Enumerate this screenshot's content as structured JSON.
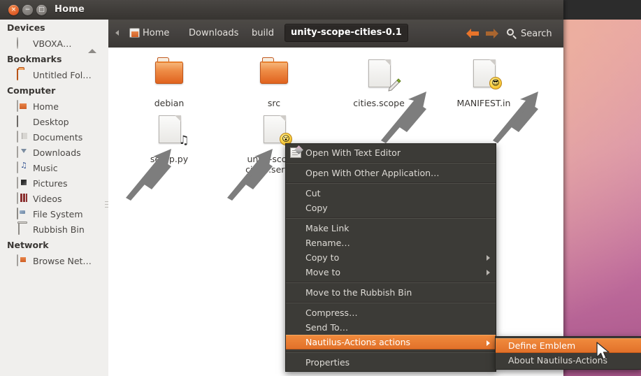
{
  "window": {
    "title": "Home",
    "controls": {
      "close_label": "×",
      "minimize_label": "−",
      "maximize_label": "□"
    }
  },
  "sidebar": {
    "sections": [
      {
        "header": "Devices",
        "items": [
          {
            "label": "VBOXA…",
            "icon": "disc-icon",
            "eject": true
          }
        ]
      },
      {
        "header": "Bookmarks",
        "items": [
          {
            "label": "Untitled Fol…",
            "icon": "folder-icon",
            "eject": false
          }
        ]
      },
      {
        "header": "Computer",
        "items": [
          {
            "label": "Home",
            "icon": "home-icon",
            "eject": false
          },
          {
            "label": "Desktop",
            "icon": "desktop-icon",
            "eject": false
          },
          {
            "label": "Documents",
            "icon": "documents-icon",
            "eject": false
          },
          {
            "label": "Downloads",
            "icon": "downloads-icon",
            "eject": false
          },
          {
            "label": "Music",
            "icon": "music-icon",
            "eject": false
          },
          {
            "label": "Pictures",
            "icon": "pictures-icon",
            "eject": false
          },
          {
            "label": "Videos",
            "icon": "videos-icon",
            "eject": false
          },
          {
            "label": "File System",
            "icon": "harddisk-icon",
            "eject": false
          },
          {
            "label": "Rubbish Bin",
            "icon": "trash-icon",
            "eject": false
          }
        ]
      },
      {
        "header": "Network",
        "items": [
          {
            "label": "Browse Net…",
            "icon": "network-icon",
            "eject": false
          }
        ]
      }
    ]
  },
  "toolbar": {
    "breadcrumbs": [
      {
        "label": "Home",
        "selected": false,
        "has_icon": true
      },
      {
        "label": "Downloads",
        "selected": false,
        "has_icon": false
      },
      {
        "label": "build",
        "selected": false,
        "has_icon": false
      },
      {
        "label": "unity-scope-cities-0.1",
        "selected": true,
        "has_icon": false
      }
    ],
    "back_label": "←",
    "forward_label": "→",
    "search_label": "Search"
  },
  "files": [
    {
      "name": "debian",
      "type": "folder",
      "emblem": null
    },
    {
      "name": "src",
      "type": "folder",
      "emblem": null
    },
    {
      "name": "cities.scope",
      "type": "file",
      "emblem": "pen-emblem"
    },
    {
      "name": "MANIFEST.in",
      "type": "file",
      "emblem": "cool-face-emblem",
      "emblem_glyph": "😎"
    },
    {
      "name": "setup.py",
      "type": "file",
      "emblem": "music-note-emblem",
      "emblem_glyph": "♫"
    },
    {
      "name": "unity-scope-cities.service",
      "type": "file",
      "emblem": "surprised-face-emblem",
      "emblem_glyph": "😮"
    }
  ],
  "context_menu": {
    "items": [
      {
        "label": "Open With Text Editor",
        "icon": "text-editor-icon",
        "submenu": false,
        "highlighted": false
      },
      {
        "separator": true
      },
      {
        "label": "Open With Other Application…",
        "icon": null,
        "submenu": false,
        "highlighted": false
      },
      {
        "separator": true
      },
      {
        "label": "Cut",
        "icon": null,
        "submenu": false,
        "highlighted": false
      },
      {
        "label": "Copy",
        "icon": null,
        "submenu": false,
        "highlighted": false
      },
      {
        "separator": true
      },
      {
        "label": "Make Link",
        "icon": null,
        "submenu": false,
        "highlighted": false
      },
      {
        "label": "Rename…",
        "icon": null,
        "submenu": false,
        "highlighted": false
      },
      {
        "label": "Copy to",
        "icon": null,
        "submenu": true,
        "highlighted": false
      },
      {
        "label": "Move to",
        "icon": null,
        "submenu": true,
        "highlighted": false
      },
      {
        "separator": true
      },
      {
        "label": "Move to the Rubbish Bin",
        "icon": null,
        "submenu": false,
        "highlighted": false
      },
      {
        "separator": true
      },
      {
        "label": "Compress…",
        "icon": null,
        "submenu": false,
        "highlighted": false
      },
      {
        "label": "Send To…",
        "icon": null,
        "submenu": false,
        "highlighted": false
      },
      {
        "label": "Nautilus-Actions actions",
        "icon": null,
        "submenu": true,
        "highlighted": true
      },
      {
        "separator": true
      },
      {
        "label": "Properties",
        "icon": null,
        "submenu": false,
        "highlighted": false
      }
    ]
  },
  "submenu": {
    "items": [
      {
        "label": "Define Emblem",
        "highlighted": true
      },
      {
        "label": "About Nautilus-Actions",
        "highlighted": false
      }
    ]
  },
  "colors": {
    "accent_orange": "#e2712a",
    "menu_bg": "#3c3b37",
    "titlebar_bg": "#403d3a",
    "sidebar_bg": "#f0efed",
    "file_area_bg": "#ffffff"
  }
}
